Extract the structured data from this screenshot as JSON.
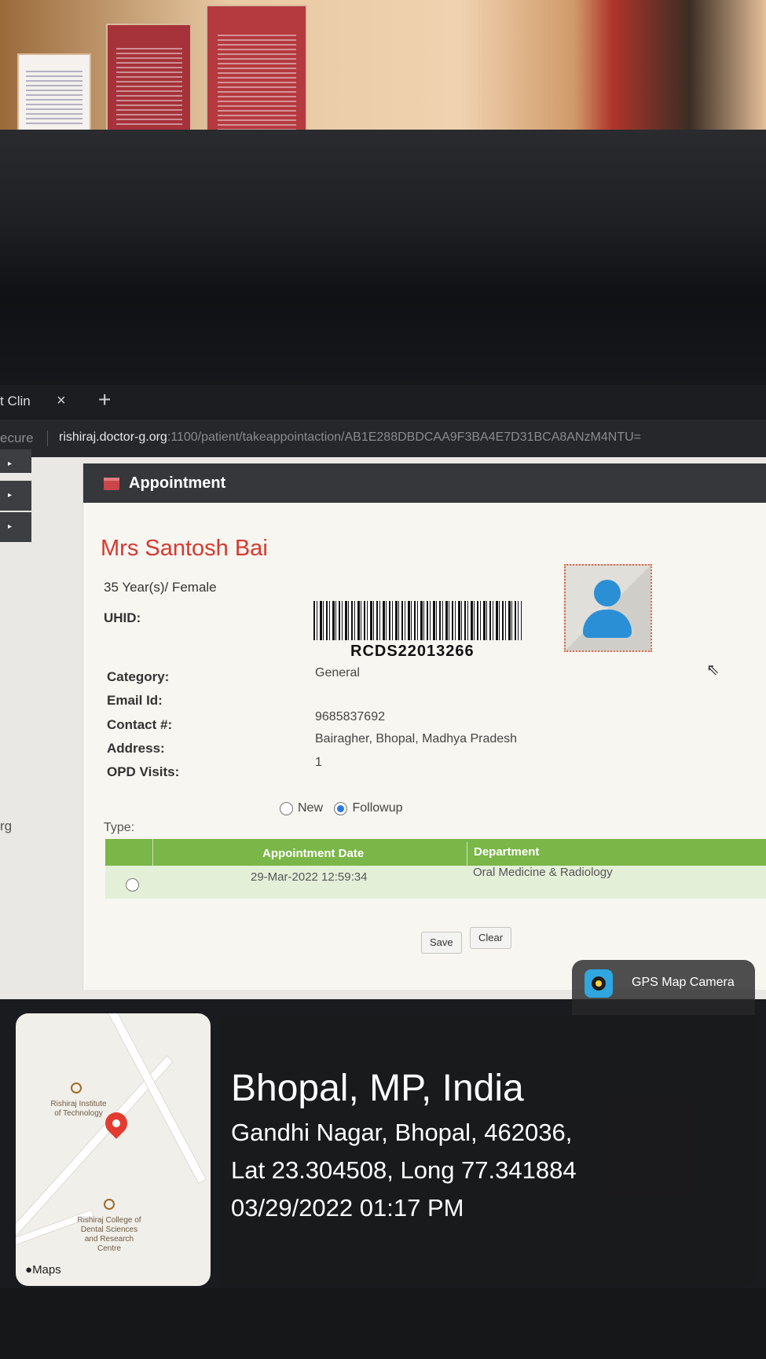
{
  "browser": {
    "tab_title": "t Clin",
    "tab_close": "×",
    "new_tab": "+",
    "security_label": "ecure",
    "url_host": "rishiraj.doctor-g.org",
    "url_path": ":1100/patient/takeappointaction/AB1E288DBDCAA9F3BA4E7D31BCA8ANzM4NTU="
  },
  "sidebar": {
    "collapse_glyph": "▸",
    "side_text": "rg"
  },
  "panel": {
    "title": "Appointment"
  },
  "patient": {
    "name": "Mrs Santosh Bai",
    "age_gender": "35 Year(s)/ Female",
    "uhid_label": "UHID:",
    "uhid": "RCDS22013266",
    "category_label": "Category:",
    "category": "General",
    "email_label": "Email Id:",
    "contact_label": "Contact #:",
    "contact": "9685837692",
    "address_label": "Address:",
    "address": "Bairagher, Bhopal, Madhya Pradesh",
    "opd_label": "OPD Visits:",
    "opd_visits": "1"
  },
  "type": {
    "label": "Type:",
    "options": [
      "New",
      "Followup"
    ],
    "selected": "Followup"
  },
  "appointments": {
    "headers": [
      "Appointment Date",
      "Department"
    ],
    "rows": [
      {
        "date": "29-Mar-2022 12:59:34",
        "department": "Oral Medicine & Radiology"
      }
    ]
  },
  "buttons": {
    "save": "Save",
    "clear": "Clear"
  },
  "gps": {
    "app_name": "GPS Map Camera",
    "city": "Bhopal, MP, India",
    "address": "Gandhi Nagar, Bhopal, 462036,",
    "coords": "Lat 23.304508, Long 77.341884",
    "datetime": "03/29/2022 01:17 PM"
  },
  "map": {
    "poi_1": "Rishiraj Institute of Technology",
    "poi_2": "Rishiraj College of Dental Sciences and Research Centre",
    "logo": "Maps"
  },
  "colors": {
    "accent_red": "#d8382f",
    "table_green": "#7ab648",
    "header_dark": "#35373b",
    "radio_blue": "#2a78e4"
  }
}
